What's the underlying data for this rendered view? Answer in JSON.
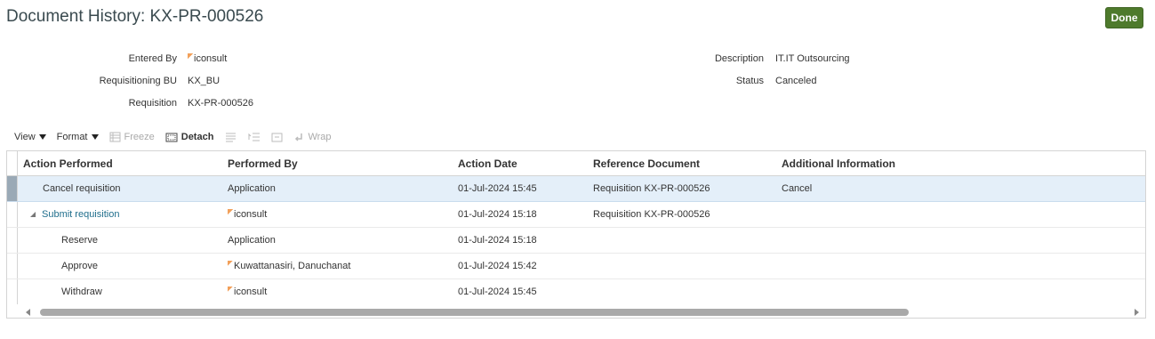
{
  "header": {
    "title": "Document History: KX-PR-000526",
    "done_label": "Done"
  },
  "fields": {
    "entered_by_label": "Entered By",
    "entered_by_value": "iconsult",
    "req_bu_label": "Requisitioning BU",
    "req_bu_value": "KX_BU",
    "requisition_label": "Requisition",
    "requisition_value": "KX-PR-000526",
    "description_label": "Description",
    "description_value": "IT.IT Outsourcing",
    "status_label": "Status",
    "status_value": "Canceled"
  },
  "toolbar": {
    "view": "View",
    "format": "Format",
    "freeze": "Freeze",
    "detach": "Detach",
    "wrap": "Wrap"
  },
  "table": {
    "columns": [
      "Action Performed",
      "Performed By",
      "Action Date",
      "Reference Document",
      "Additional Information"
    ],
    "rows": [
      {
        "action": "Cancel requisition",
        "by": "Application",
        "date": "01-Jul-2024 15:45",
        "ref": "Requisition KX-PR-000526",
        "info": "Cancel"
      },
      {
        "action": "Submit requisition",
        "by": "iconsult",
        "date": "01-Jul-2024 15:18",
        "ref": "Requisition KX-PR-000526",
        "info": ""
      },
      {
        "action": "Reserve",
        "by": "Application",
        "date": "01-Jul-2024 15:18",
        "ref": "",
        "info": ""
      },
      {
        "action": "Approve",
        "by": "Kuwattanasiri, Danuchanat",
        "date": "01-Jul-2024 15:42",
        "ref": "",
        "info": ""
      },
      {
        "action": "Withdraw",
        "by": "iconsult",
        "date": "01-Jul-2024 15:45",
        "ref": "",
        "info": ""
      }
    ]
  },
  "colors": {
    "done_button": "#4e7a2c",
    "selected_row": "#e4eff9",
    "link": "#1f6e8c"
  }
}
